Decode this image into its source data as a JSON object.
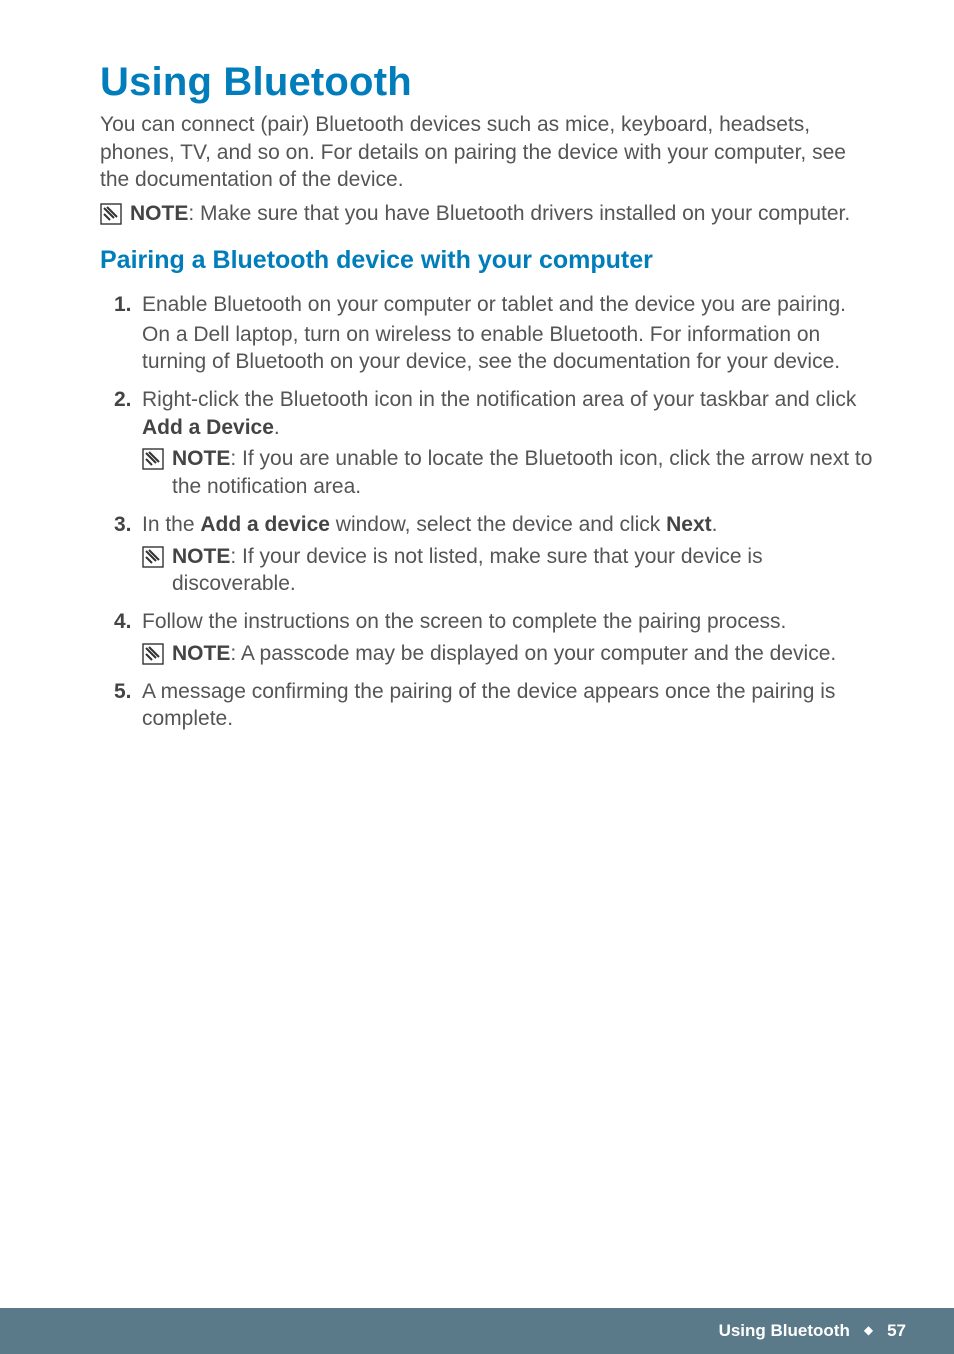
{
  "heading": "Using Bluetooth",
  "intro": "You can connect (pair) Bluetooth devices such as mice, keyboard, headsets, phones, TV, and so on. For details on pairing the device with your computer, see the documentation of the device.",
  "top_note": {
    "label": "NOTE",
    "text": ": Make sure that you have Bluetooth drivers installed on your computer."
  },
  "subheading": "Pairing a Bluetooth device with your computer",
  "steps": [
    {
      "num": "1.",
      "body": "Enable Bluetooth on your computer or tablet and the device you are pairing.",
      "extra": "On a Dell laptop, turn on wireless to enable Bluetooth. For information on turning of Bluetooth on your device, see the documentation for your device."
    },
    {
      "num": "2.",
      "body_pre": "Right-click the Bluetooth icon in the notification area of your taskbar and click ",
      "body_bold": "Add a Device",
      "body_post": ".",
      "note": {
        "label": "NOTE",
        "text": ": If you are unable to locate the Bluetooth icon, click the arrow next to the notification area."
      }
    },
    {
      "num": "3.",
      "body_pre": "In the ",
      "body_bold1": "Add a device",
      "body_mid": " window, select the device and click ",
      "body_bold2": "Next",
      "body_post": ".",
      "note": {
        "label": "NOTE",
        "text": ": If your device is not listed, make sure that your device is discoverable."
      }
    },
    {
      "num": "4.",
      "body": "Follow the instructions on the screen to complete the pairing process.",
      "note": {
        "label": "NOTE",
        "text": ": A passcode may be displayed on your computer and the device."
      }
    },
    {
      "num": "5.",
      "body": "A message confirming the pairing of the device appears once the pairing is complete."
    }
  ],
  "footer": {
    "title": "Using Bluetooth",
    "separator": "◆",
    "page": "57"
  }
}
